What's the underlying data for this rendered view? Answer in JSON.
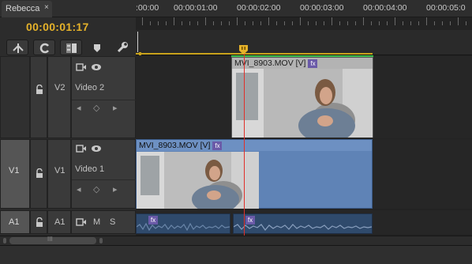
{
  "tab": {
    "title": "Rebecca",
    "close": "×"
  },
  "timecode": "00:00:01:17",
  "ruler": {
    "labels": [
      ":00:00",
      "00:00:01:00",
      "00:00:02:00",
      "00:00:03:00",
      "00:00:04:00",
      "00:00:05:0"
    ]
  },
  "tracks": {
    "v2": {
      "target": "",
      "name": "V2",
      "label": "Video 2"
    },
    "v1": {
      "target": "V1",
      "name": "V1",
      "label": "Video 1"
    },
    "a1": {
      "target": "A1",
      "name": "A1",
      "mute": "M",
      "solo": "S"
    }
  },
  "clips": {
    "v2": {
      "name": "MVI_8903.MOV [V]",
      "fx": "fx"
    },
    "v1": {
      "name": "MVI_8903.MOV [V]",
      "fx": "fx"
    },
    "a1a": {
      "fx": "fx"
    },
    "a1b": {
      "fx": "fx"
    }
  },
  "scroll": {
    "grip": "III"
  },
  "colors": {
    "timecode": "#e5b22a",
    "video_clip": "#5f83b6",
    "audio_clip": "#2f4a6c",
    "playhead": "#e0302a",
    "work_area": "#c9a21c",
    "v2_clip_marker": "#3fbf4f"
  },
  "icons": [
    "close-icon",
    "snap-icon",
    "linked-selection-icon",
    "add-marker-icon",
    "marker-icon",
    "wrench-icon",
    "lock-icon",
    "camera-icon",
    "eye-icon",
    "keyframe-prev-icon",
    "keyframe-add-icon",
    "keyframe-next-icon",
    "speaker-icon",
    "fx-icon",
    "playhead-icon"
  ]
}
